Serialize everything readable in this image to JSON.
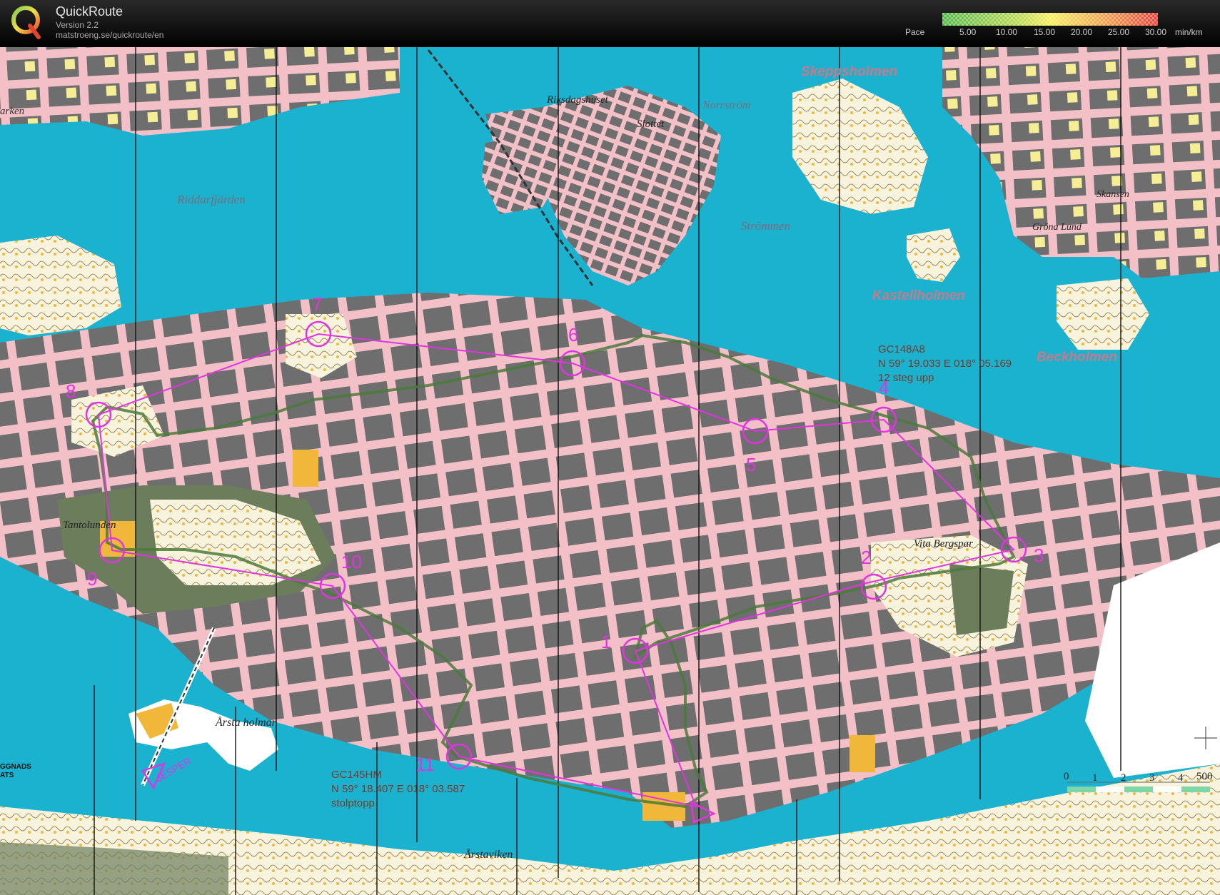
{
  "header": {
    "app_name": "QuickRoute",
    "version": "Version 2.2",
    "url": "matstroeng.se/quickroute/en",
    "logo_letter": "Q",
    "pace_label": "Pace",
    "pace_ticks": [
      "5.00",
      "10.00",
      "15.00",
      "20.00",
      "25.00",
      "30.00"
    ],
    "pace_unit": "min/km"
  },
  "map": {
    "place_names": {
      "riddarfjarden": "Riddarfjärden",
      "skeppsholmen": "Skeppsholmen",
      "kastellholmen": "Kastellholmen",
      "beckholmen": "Beckholmen",
      "strommen": "Strömmen",
      "norrstrom": "Norrström",
      "riksdagshuset": "Riksdagshuset",
      "slottet": "Slottet",
      "skansen": "Skansen",
      "grona_lund": "Gröna Lund",
      "tantolunden": "Tantolunden",
      "vita_bergsparken": "Vita Bergspar",
      "arsta_holmar": "Årsta holmar",
      "arstaviken": "Årstaviken",
      "arken": "arken",
      "jesper": "JESPER",
      "ggnads": "GGNADS",
      "ats": "ATS"
    },
    "controls": [
      "1",
      "2",
      "3",
      "4",
      "5",
      "6",
      "7",
      "8",
      "9",
      "10",
      "11"
    ],
    "annotations": {
      "gc148a8": {
        "code": "GC148A8",
        "coords": "N 59° 19.033 E 018° 05.169",
        "note": "12 steg upp"
      },
      "gc145hm": {
        "code": "GC145HM",
        "coords": "N 59° 18.407 E 018° 03.587",
        "note": "stolptopp"
      }
    },
    "scale_labels": [
      "0",
      "1",
      "2",
      "3",
      "4",
      "500"
    ],
    "colors": {
      "water": "#1bb2cf",
      "built_area": "#f3c0c8",
      "building": "#6e6e6e",
      "open_land": "#f6ee94",
      "green": "#6c7d5c",
      "course": "#e034e0",
      "route": "#4b7a3c"
    }
  }
}
